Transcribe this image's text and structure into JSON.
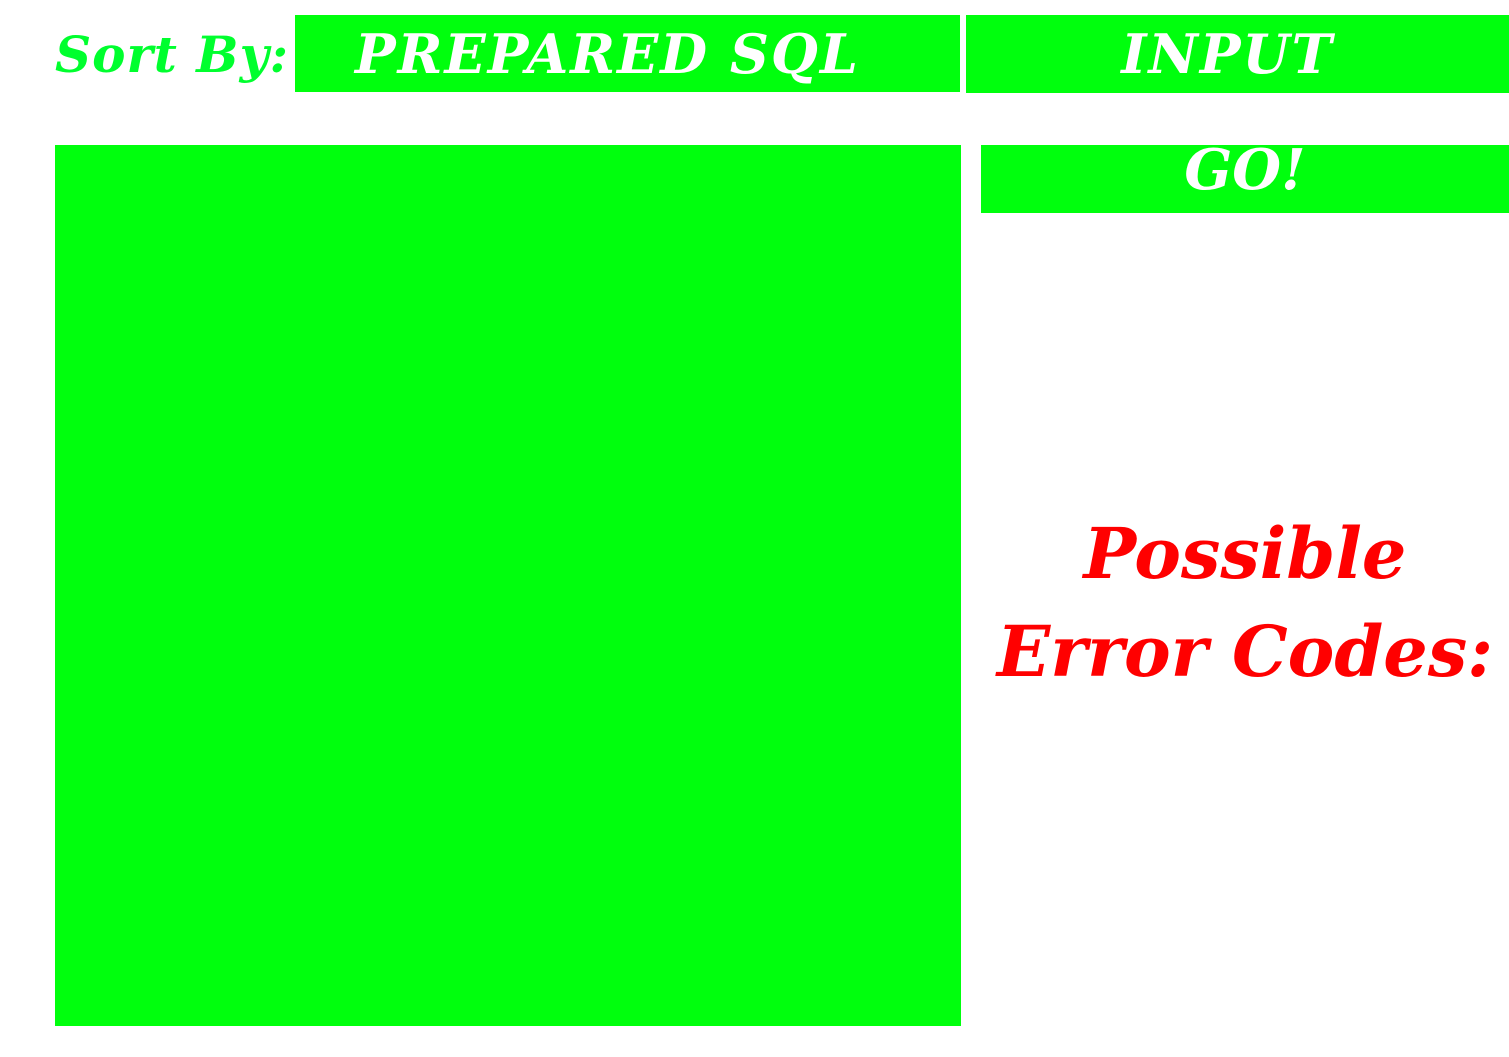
{
  "sort": {
    "label": "Sort By:",
    "option_label": "PREPARED SQL"
  },
  "input": {
    "value": "INPUT"
  },
  "go_button": {
    "label": "GO!"
  },
  "errors": {
    "title": "Possible Error Codes:"
  },
  "colors": {
    "accent_green": "#00ff0d",
    "label_green": "#00ff2e",
    "error_red": "#ff0000",
    "button_text": "#ffffff"
  }
}
